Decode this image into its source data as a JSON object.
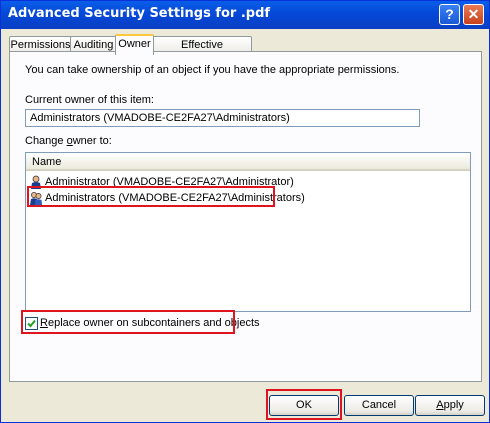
{
  "window": {
    "title": "Advanced Security Settings for .pdf",
    "help_icon": "question-mark",
    "close_icon": "x"
  },
  "tabs": [
    {
      "label": "Permissions"
    },
    {
      "label": "Auditing"
    },
    {
      "label": "Owner",
      "active": true
    },
    {
      "label": "Effective Permissions"
    }
  ],
  "owner_tab": {
    "intro": "You can take ownership of an object if you have the appropriate permissions.",
    "current_owner_label": "Current owner of this item:",
    "current_owner_value": "Administrators (VMADOBE-CE2FA27\\Administrators)",
    "change_owner_prefix": "Change ",
    "change_owner_mnemonic": "o",
    "change_owner_suffix": "wner to:",
    "list_header": "Name",
    "list_items": [
      {
        "label": "Administrator (VMADOBE-CE2FA27\\Administrator)",
        "icon": "user-icon"
      },
      {
        "label": "Administrators (VMADOBE-CE2FA27\\Administrators)",
        "icon": "group-icon",
        "highlighted": true
      }
    ],
    "replace_owner_mnemonic": "R",
    "replace_owner_rest": "eplace owner on subcontainers and objects",
    "replace_owner_checked": true
  },
  "buttons": {
    "ok": "OK",
    "cancel": "Cancel",
    "apply_mnemonic": "A",
    "apply_rest": "pply"
  },
  "colors": {
    "highlight": "#e0141e",
    "titlebar": "#0548d8"
  }
}
